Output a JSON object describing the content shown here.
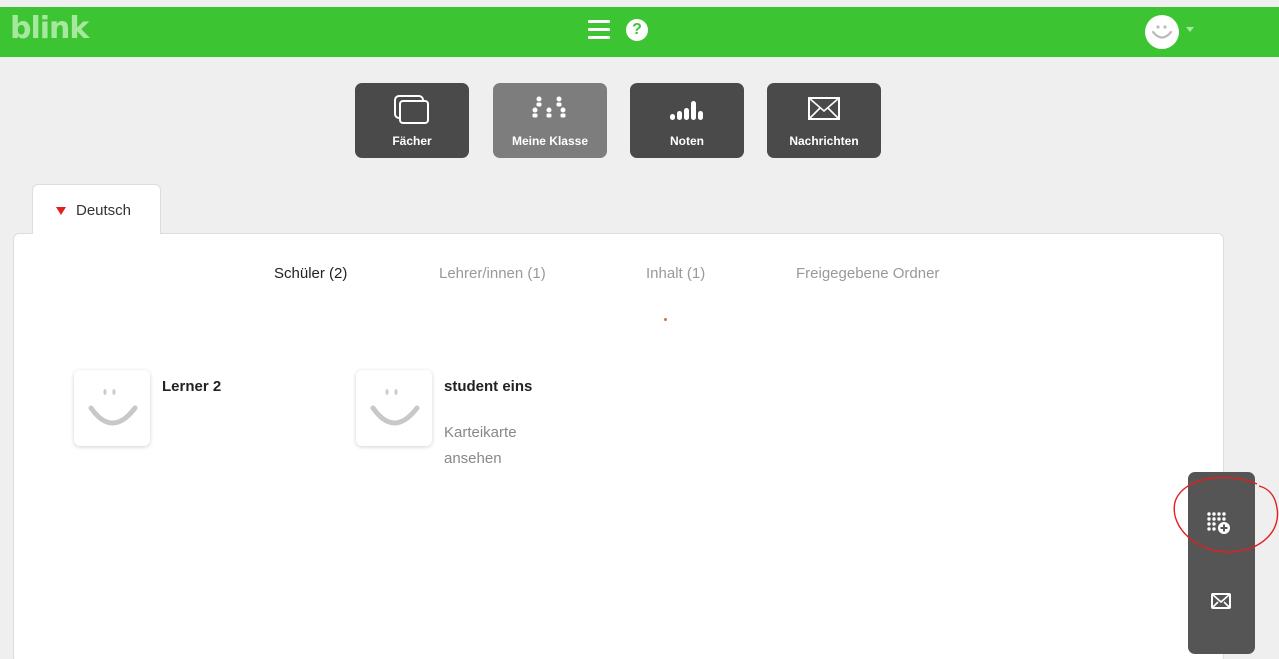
{
  "header": {
    "logo": "blink",
    "menu_icon": "hamburger-menu-icon",
    "help_icon": "help-question-icon",
    "avatar_icon": "smiley-avatar-icon",
    "brand_color": "#3dc432"
  },
  "nav": [
    {
      "label": "Fächer",
      "icon": "stacked-windows-icon"
    },
    {
      "label": "Meine Klasse",
      "icon": "people-group-icon",
      "active": true
    },
    {
      "label": "Noten",
      "icon": "bar-signal-icon"
    },
    {
      "label": "Nachrichten",
      "icon": "envelope-icon"
    }
  ],
  "class_tab": {
    "label": "Deutsch"
  },
  "subtabs": [
    {
      "label": "Schüler (2)",
      "active": true
    },
    {
      "label": "Lehrer/innen (1)"
    },
    {
      "label": "Inhalt (1)"
    },
    {
      "label": "Freigegebene Ordner"
    }
  ],
  "students": [
    {
      "name": "Lerner 2",
      "link": ""
    },
    {
      "name": "student eins",
      "link": "Karteikarte ansehen"
    }
  ],
  "side_dock": [
    {
      "icon": "grid-add-icon"
    },
    {
      "icon": "envelope-icon"
    }
  ]
}
